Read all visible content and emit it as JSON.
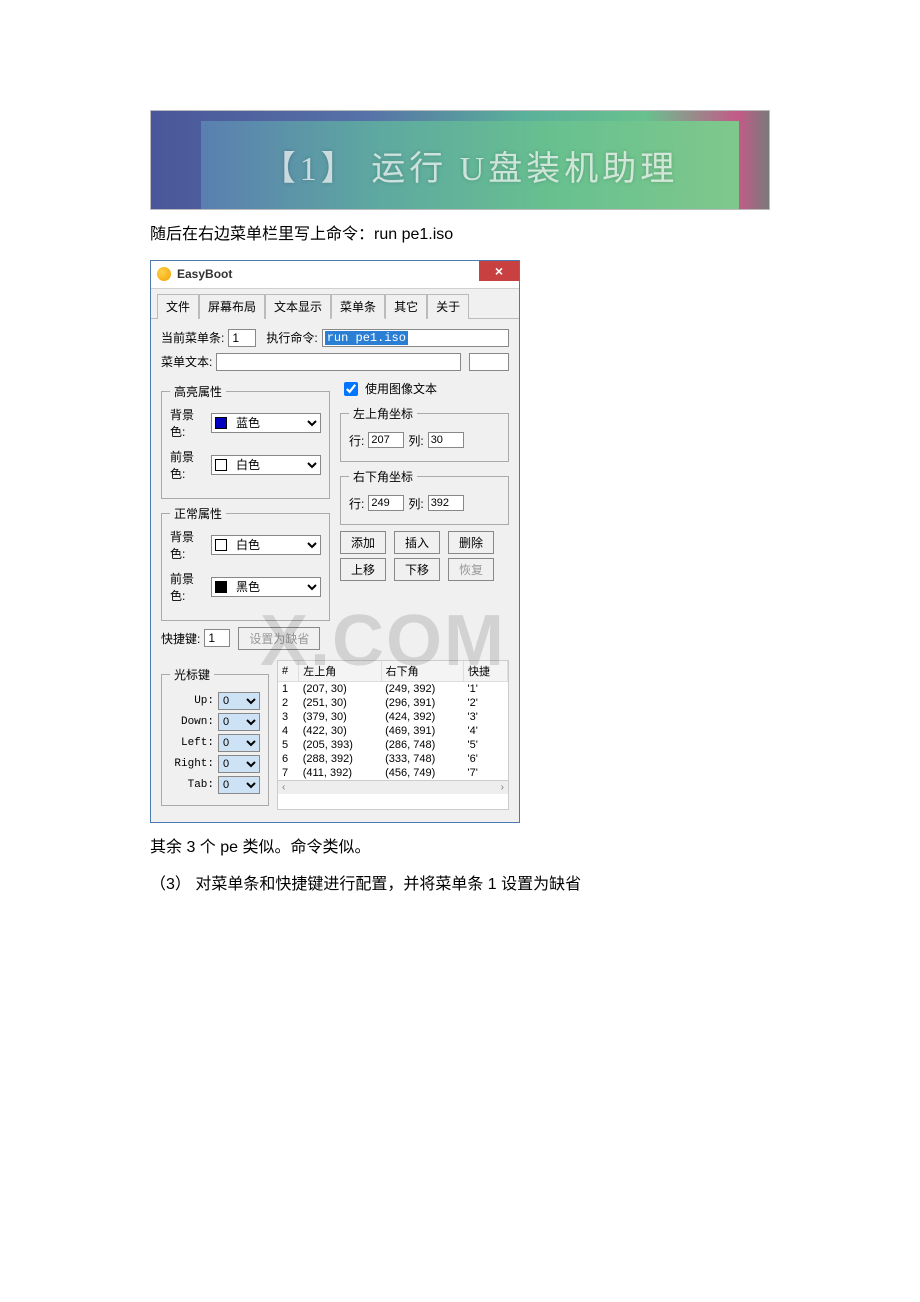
{
  "banner": {
    "text": "【1】 运行 U盘装机助理"
  },
  "caption1": "随后在右边菜单栏里写上命令：run pe1.iso",
  "window": {
    "title": "EasyBoot",
    "closeGlyph": "×",
    "tabs": [
      "文件",
      "屏幕布局",
      "文本显示",
      "菜单条",
      "其它",
      "关于"
    ],
    "activeTab": 3,
    "currentBarLabel": "当前菜单条:",
    "currentBarValue": "1",
    "runCmdLabel": "执行命令:",
    "runCmdValue": "run pe1.iso",
    "menuTextLabel": "菜单文本:",
    "menuTextValue": "",
    "highlightGroup": {
      "legend": "高亮属性",
      "bgLabel": "背景色:",
      "bgValue": "蓝色",
      "fgLabel": "前景色:",
      "fgValue": "白色"
    },
    "normalGroup": {
      "legend": "正常属性",
      "bgLabel": "背景色:",
      "bgValue": "白色",
      "fgLabel": "前景色:",
      "fgValue": "黑色"
    },
    "useImageTextLabel": "使用图像文本",
    "useImageTextChecked": true,
    "topLeft": {
      "legend": "左上角坐标",
      "rowLabel": "行:",
      "rowValue": "207",
      "colLabel": "列:",
      "colValue": "30"
    },
    "bottomRight": {
      "legend": "右下角坐标",
      "rowLabel": "行:",
      "rowValue": "249",
      "colLabel": "列:",
      "colValue": "392"
    },
    "buttons": {
      "add": "添加",
      "insert": "插入",
      "delete": "删除",
      "moveUp": "上移",
      "moveDown": "下移",
      "restore": "恢复"
    },
    "hotkeyLabel": "快捷键:",
    "hotkeyValue": "1",
    "setDefault": "设置为缺省",
    "cursorGroup": {
      "legend": "光标键",
      "up": "Up:",
      "down": "Down:",
      "left": "Left:",
      "right": "Right:",
      "tab": "Tab:",
      "selVal": "0"
    },
    "table": {
      "headers": [
        "#",
        "左上角",
        "右下角",
        "快捷"
      ],
      "rows": [
        {
          "n": "1",
          "tl": "(207, 30)",
          "br": "(249, 392)",
          "k": "'1'"
        },
        {
          "n": "2",
          "tl": "(251, 30)",
          "br": "(296, 391)",
          "k": "'2'"
        },
        {
          "n": "3",
          "tl": "(379, 30)",
          "br": "(424, 392)",
          "k": "'3'"
        },
        {
          "n": "4",
          "tl": "(422, 30)",
          "br": "(469, 391)",
          "k": "'4'"
        },
        {
          "n": "5",
          "tl": "(205, 393)",
          "br": "(286, 748)",
          "k": "'5'"
        },
        {
          "n": "6",
          "tl": "(288, 392)",
          "br": "(333, 748)",
          "k": "'6'"
        },
        {
          "n": "7",
          "tl": "(411, 392)",
          "br": "(456, 749)",
          "k": "'7'"
        }
      ]
    }
  },
  "caption2": "其余 3 个 pe 类似。命令类似。",
  "caption3": "（3） 对菜单条和快捷键进行配置，并将菜单条 1 设置为缺省",
  "watermark": "X.COM"
}
